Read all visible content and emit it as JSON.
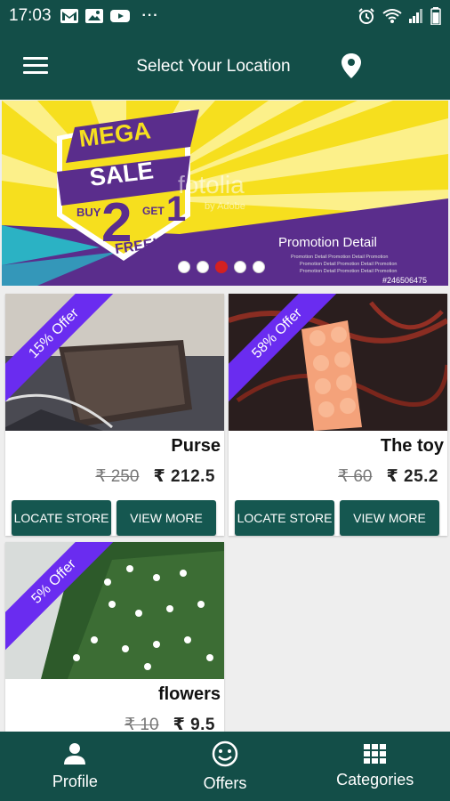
{
  "status_bar": {
    "time": "17:03",
    "dots": "···"
  },
  "app_bar": {
    "title": "Select Your Location"
  },
  "banner": {
    "line1": "MEGA",
    "line2": "SALE",
    "buy": "BUY",
    "big": "2",
    "one": "1",
    "get": "GET",
    "free": "FREE!",
    "watermark": "fotolia",
    "watermark_sub": "by Adobe",
    "promo_title": "Promotion Detail",
    "promo_small": "Promotion Detail Promotion Detail Promotion",
    "promo_id": "#246506475",
    "slide_count": 5,
    "active_slide": 3
  },
  "products": [
    {
      "offer": "15% Offer",
      "name": "Purse",
      "old_price": "₹ 250",
      "new_price": "₹ 212.5",
      "locate_label": "LOCATE STORE",
      "view_label": "VIEW MORE"
    },
    {
      "offer": "58% Offer",
      "name": "The toy",
      "old_price": "₹ 60",
      "new_price": "₹ 25.2",
      "locate_label": "LOCATE STORE",
      "view_label": "VIEW MORE"
    },
    {
      "offer": "5% Offer",
      "name": "flowers",
      "old_price": "₹ 10",
      "new_price": "₹ 9.5"
    }
  ],
  "bottom_nav": {
    "items": [
      {
        "label": "Profile",
        "icon": "person-icon"
      },
      {
        "label": "Offers",
        "icon": "smiley-icon"
      },
      {
        "label": "Categories",
        "icon": "grid-icon"
      }
    ]
  },
  "colors": {
    "primary": "#134e48",
    "button": "#155750",
    "ribbon": "#6a2cf0",
    "active_dot": "#d32121"
  }
}
